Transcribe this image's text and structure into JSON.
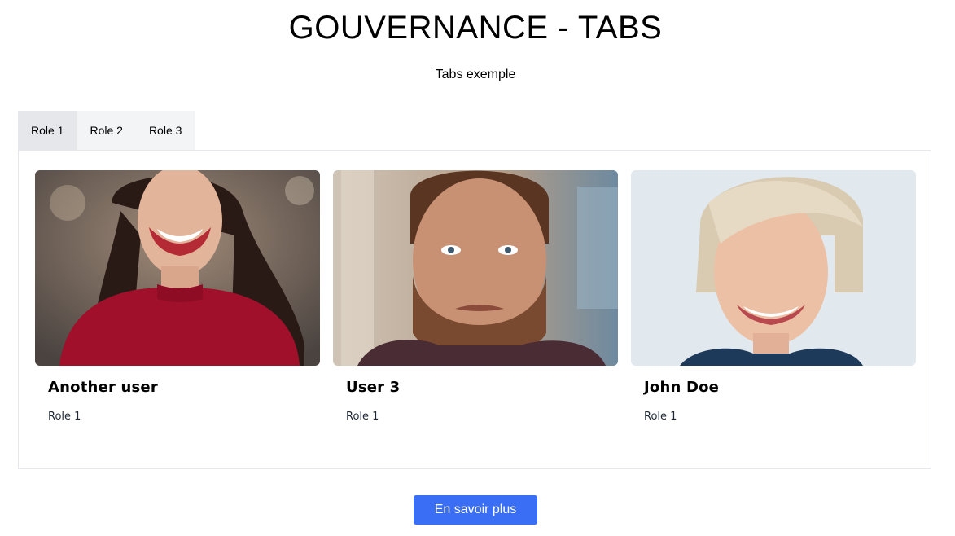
{
  "page": {
    "title": "GOUVERNANCE - TABS",
    "subtitle": "Tabs exemple"
  },
  "tabs": [
    {
      "label": "Role 1",
      "active": true
    },
    {
      "label": "Role 2",
      "active": false
    },
    {
      "label": "Role 3",
      "active": false
    }
  ],
  "members": [
    {
      "name": "Another user",
      "role": "Role 1",
      "photo_icon": "woman-red-sweater-portrait"
    },
    {
      "name": "User 3",
      "role": "Role 1",
      "photo_icon": "bearded-man-portrait"
    },
    {
      "name": "John Doe",
      "role": "Role 1",
      "photo_icon": "blonde-woman-portrait"
    }
  ],
  "cta": {
    "label": "En savoir plus"
  },
  "colors": {
    "accent": "#3a6ff5",
    "tab_active_bg": "#e5e7eb",
    "tab_bar_bg": "#f3f4f6"
  }
}
